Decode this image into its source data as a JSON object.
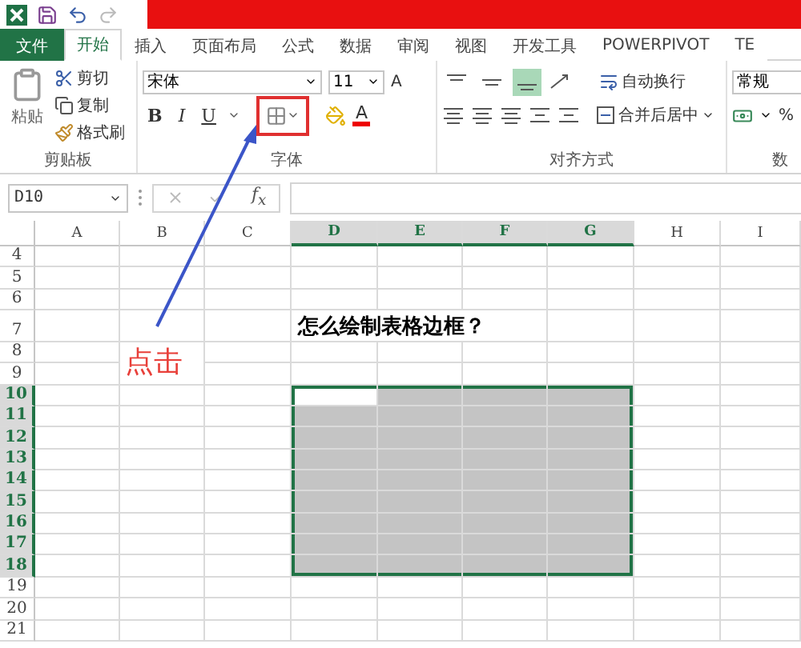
{
  "quick_access": [
    {
      "kind": "save",
      "disabled": false
    },
    {
      "kind": "undo",
      "disabled": false
    },
    {
      "kind": "redo",
      "disabled": true
    }
  ],
  "tabs": [
    {
      "label": "文件",
      "kind": "file",
      "selected": false
    },
    {
      "label": "开始",
      "kind": "tab",
      "selected": true
    },
    {
      "label": "插入",
      "kind": "tab",
      "selected": false
    },
    {
      "label": "页面布局",
      "kind": "tab",
      "selected": false
    },
    {
      "label": "公式",
      "kind": "tab",
      "selected": false
    },
    {
      "label": "数据",
      "kind": "tab",
      "selected": false
    },
    {
      "label": "审阅",
      "kind": "tab",
      "selected": false
    },
    {
      "label": "视图",
      "kind": "tab",
      "selected": false
    },
    {
      "label": "开发工具",
      "kind": "tab",
      "selected": false
    },
    {
      "label": "POWERPIVOT",
      "kind": "tab",
      "selected": false
    },
    {
      "label": "TE",
      "kind": "tab",
      "selected": false
    }
  ],
  "ribbon": {
    "clipboard": {
      "label": "剪贴板",
      "paste": "粘贴",
      "items": [
        {
          "kind": "cut",
          "label": "剪切"
        },
        {
          "kind": "copy",
          "label": "复制"
        },
        {
          "kind": "format_painter",
          "label": "格式刷"
        }
      ]
    },
    "font": {
      "label": "字体",
      "font_name": "宋体",
      "font_size": "11",
      "grow": "A",
      "styles": [
        "B",
        "I",
        "U"
      ],
      "border_highlighted": true,
      "font_color": "A"
    },
    "alignment": {
      "label": "对齐方式",
      "vertical": [
        {
          "kind": "top",
          "selected": false
        },
        {
          "kind": "middle",
          "selected": false
        },
        {
          "kind": "bottom",
          "selected": true
        }
      ],
      "wrap": "自动换行",
      "merge": "合并后居中"
    },
    "number": {
      "label": "数",
      "format": "常规",
      "percent": "%"
    }
  },
  "formula_bar": {
    "name_box": "D10",
    "fx": "f$_{x}$"
  },
  "sheet": {
    "columns": [
      {
        "label": "A",
        "selected": false
      },
      {
        "label": "B",
        "selected": false
      },
      {
        "label": "C",
        "selected": false
      },
      {
        "label": "D",
        "selected": true
      },
      {
        "label": "E",
        "selected": true
      },
      {
        "label": "F",
        "selected": true
      },
      {
        "label": "G",
        "selected": true
      },
      {
        "label": "H",
        "selected": false
      },
      {
        "label": "I",
        "selected": false
      }
    ],
    "rows": [
      {
        "label": "4",
        "kind": "normal",
        "selected": false
      },
      {
        "label": "5",
        "kind": "normal",
        "selected": false
      },
      {
        "label": "6",
        "kind": "normal",
        "selected": false
      },
      {
        "label": "7",
        "kind": "title",
        "selected": false,
        "cells": [
          null,
          null,
          null,
          "怎么绘制表格边框？"
        ]
      },
      {
        "label": "8",
        "kind": "normal",
        "selected": false
      },
      {
        "label": "9",
        "kind": "normal",
        "selected": false
      },
      {
        "label": "10",
        "kind": "normal",
        "selected": true
      },
      {
        "label": "11",
        "kind": "normal",
        "selected": true
      },
      {
        "label": "12",
        "kind": "normal",
        "selected": true
      },
      {
        "label": "13",
        "kind": "normal",
        "selected": true
      },
      {
        "label": "14",
        "kind": "normal",
        "selected": true
      },
      {
        "label": "15",
        "kind": "normal",
        "selected": true
      },
      {
        "label": "16",
        "kind": "normal",
        "selected": true
      },
      {
        "label": "17",
        "kind": "normal",
        "selected": true
      },
      {
        "label": "18",
        "kind": "normal",
        "selected": true
      },
      {
        "label": "19",
        "kind": "normal",
        "selected": false
      },
      {
        "label": "20",
        "kind": "normal",
        "selected": false
      },
      {
        "label": "21",
        "kind": "normal",
        "selected": false
      }
    ]
  },
  "annotation": {
    "text": "点击"
  }
}
